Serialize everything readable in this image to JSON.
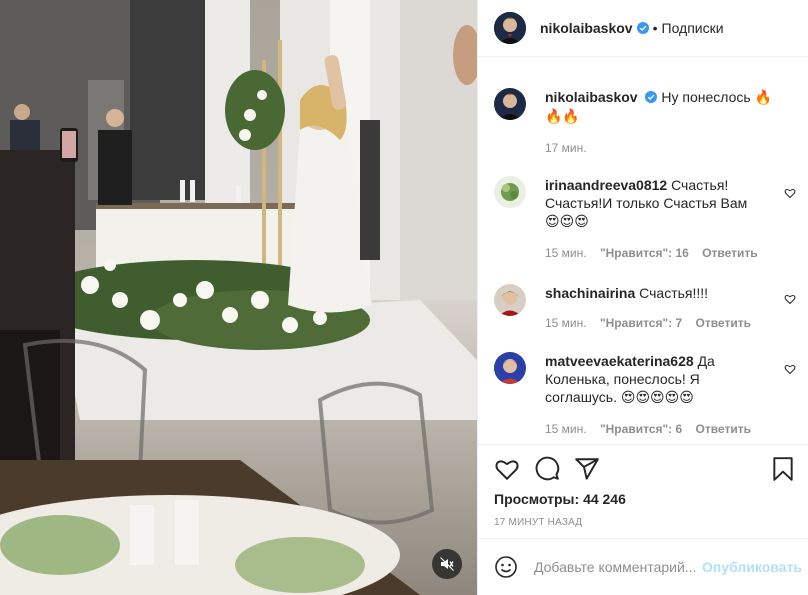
{
  "post": {
    "author": "nikolaibaskov",
    "follow_label": "Подписки",
    "dot": "•"
  },
  "caption": {
    "username": "nikolaibaskov",
    "text": "Ну понеслось",
    "emoji": "🔥🔥🔥",
    "time": "17 мин."
  },
  "comments": [
    {
      "username": "irinaandreeva0812",
      "text": "Счастья! Счастья!И только Счастья Вам",
      "emoji": "😍😍😍",
      "time": "15 мин.",
      "likes": "\"Нравится\": 16",
      "reply": "Ответить"
    },
    {
      "username": "shachinairina",
      "text": "Счастья!!!!",
      "emoji": "",
      "time": "15 мин.",
      "likes": "\"Нравится\": 7",
      "reply": "Ответить"
    },
    {
      "username": "matveevaekaterina628",
      "text": "Да Коленька, понеслось! Я соглашусь.",
      "emoji": "😍😍😍😍😍",
      "time": "15 мин.",
      "likes": "\"Нравится\": 6",
      "reply": "Ответить"
    }
  ],
  "stats": {
    "views_label": "Просмотры:",
    "views": "44 246",
    "posted": "17 МИНУТ НАЗАД"
  },
  "composer": {
    "placeholder": "Добавьте комментарий...",
    "publish_label": "Опубликовать"
  },
  "icons": {
    "like": "heart-icon",
    "comment": "comment-icon",
    "share": "share-icon",
    "save": "bookmark-icon",
    "mute": "speaker-muted-icon",
    "emoji": "smiley-icon"
  },
  "colors": {
    "verified": "#3897f0",
    "meta": "#8e8e8e",
    "publish_disabled": "#b2dffc",
    "divider": "#efefef"
  }
}
